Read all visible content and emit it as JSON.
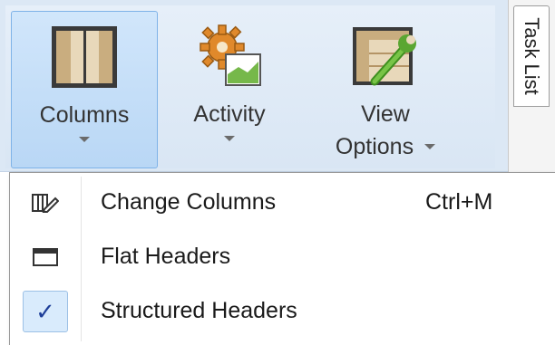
{
  "ribbon": {
    "buttons": [
      {
        "label": "Columns",
        "icon": "columns-icon",
        "has_dropdown": true,
        "active": true
      },
      {
        "label": "Activity",
        "icon": "activity-gear-icon",
        "has_dropdown": true
      },
      {
        "label_line1": "View",
        "label_line2": "Options",
        "icon": "view-options-wrench-icon",
        "has_dropdown": true
      }
    ]
  },
  "side_tab": {
    "label": "Task List"
  },
  "menu": {
    "items": [
      {
        "label": "Change Columns",
        "shortcut": "Ctrl+M",
        "icon": "edit-columns-icon",
        "checked": false
      },
      {
        "label": "Flat Headers",
        "shortcut": "",
        "icon": "flat-headers-icon",
        "checked": false
      },
      {
        "label": "Structured Headers",
        "shortcut": "",
        "icon": "check-icon",
        "checked": true
      }
    ]
  },
  "colors": {
    "ribbon_bg": "#dce8f5",
    "active_button_border": "#7fb3e8",
    "check_color": "#1f3f99"
  }
}
